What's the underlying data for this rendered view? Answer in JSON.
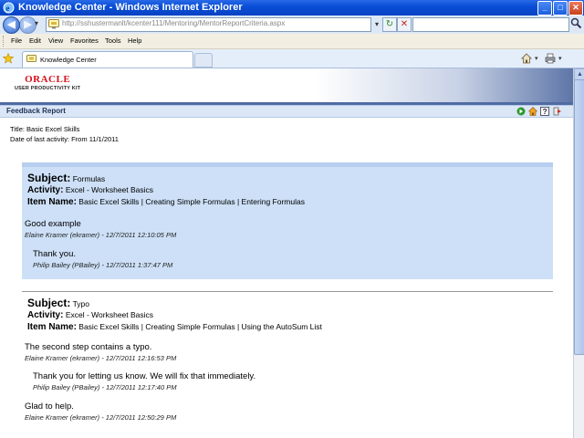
{
  "window": {
    "title": "Knowledge Center - Windows Internet Explorer",
    "buttons": {
      "minimize": "_",
      "maximize": "□",
      "close": "✕"
    }
  },
  "address": {
    "url": "http://sshustermanlt/kcenter111/Mentoring/MentorReportCriteria.aspx",
    "back_label": "◀",
    "forward_label": "▶",
    "dropdown_glyph": "▾",
    "refresh_glyph": "↻",
    "stop_glyph": "✕",
    "search_placeholder": ""
  },
  "menu": [
    "File",
    "Edit",
    "View",
    "Favorites",
    "Tools",
    "Help"
  ],
  "tabs": {
    "active_label": "Knowledge Center"
  },
  "banner": {
    "brand": "ORACLE",
    "product": "USER PRODUCTIVITY KIT"
  },
  "report": {
    "title": "Feedback Report",
    "meta_title": "Title: Basic Excel Skills",
    "meta_date": "Date of last activity: From 11/1/2011"
  },
  "labels": {
    "subject": "Subject:",
    "activity": "Activity:",
    "item_name": "Item Name:"
  },
  "entries": [
    {
      "subject": "Formulas",
      "activity": "Excel - Worksheet Basics",
      "item_name": "Basic Excel Skills | Creating Simple Formulas | Entering Formulas",
      "comments": [
        {
          "text": "Good example",
          "byline": "Elaine Kramer (ekramer) - 12/7/2011 12:10:05 PM",
          "reply": false
        },
        {
          "text": "Thank you.",
          "byline": "Philip Bailey (PBailey) - 12/7/2011 1:37:47 PM",
          "reply": true
        }
      ]
    },
    {
      "subject": "Typo",
      "activity": "Excel - Worksheet Basics",
      "item_name": "Basic Excel Skills | Creating Simple Formulas | Using the AutoSum List",
      "comments": [
        {
          "text": "The second step contains a typo.",
          "byline": "Elaine Kramer (ekramer) - 12/7/2011 12:16:53 PM",
          "reply": false
        },
        {
          "text": "Thank you for letting us know. We will fix that immediately.",
          "byline": "Philip Bailey (PBailey) - 12/7/2011 12:17:40 PM",
          "reply": true
        },
        {
          "text": "Glad to help.",
          "byline": "Elaine Kramer (ekramer) - 12/7/2011 12:50:29 PM",
          "reply": false
        }
      ]
    }
  ],
  "colors": {
    "titlebar": "#0a4fd6",
    "entry_shade": "#cde0f7",
    "oracle_red": "#d6111a"
  }
}
